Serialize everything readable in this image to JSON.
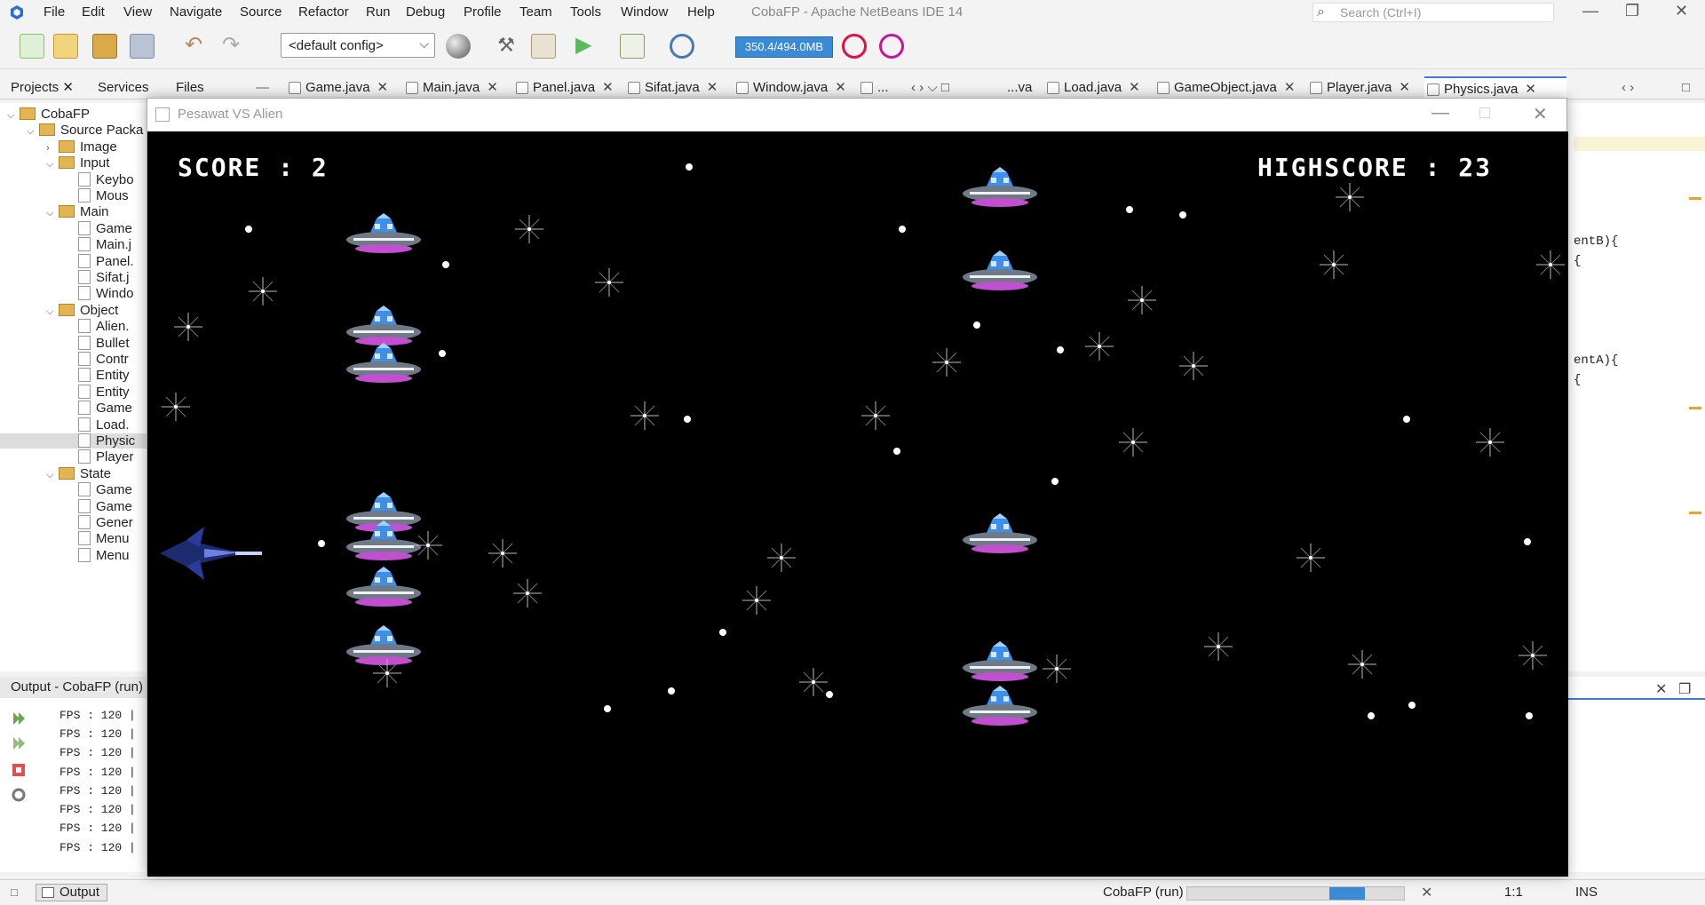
{
  "ide": {
    "menus": [
      "File",
      "Edit",
      "View",
      "Navigate",
      "Source",
      "Refactor",
      "Run",
      "Debug",
      "Profile",
      "Team",
      "Tools",
      "Window",
      "Help"
    ],
    "window_title": "CobaFP - Apache NetBeans IDE 14",
    "search_placeholder": "Search (Ctrl+I)",
    "config_value": "<default config>",
    "memory": "350.4/494.0MB",
    "panel_tabs": [
      "Projects",
      "Services",
      "Files"
    ],
    "editor_tabs": [
      "Game.java",
      "Main.java",
      "Panel.java",
      "Sifat.java",
      "Window.java",
      "...",
      "...va",
      "Load.java",
      "GameObject.java",
      "Player.java",
      "Physics.java"
    ],
    "active_tab": "Physics.java",
    "tree": [
      {
        "label": "CobaFP",
        "level": 0,
        "kind": "project"
      },
      {
        "label": "Source Packa",
        "level": 1,
        "kind": "folder"
      },
      {
        "label": "Image",
        "level": 2,
        "kind": "package"
      },
      {
        "label": "Input",
        "level": 2,
        "kind": "package"
      },
      {
        "label": "Keybo",
        "level": 3,
        "kind": "file"
      },
      {
        "label": "Mous",
        "level": 3,
        "kind": "file"
      },
      {
        "label": "Main",
        "level": 2,
        "kind": "package"
      },
      {
        "label": "Game",
        "level": 3,
        "kind": "file"
      },
      {
        "label": "Main.j",
        "level": 3,
        "kind": "file"
      },
      {
        "label": "Panel.",
        "level": 3,
        "kind": "file"
      },
      {
        "label": "Sifat.j",
        "level": 3,
        "kind": "file"
      },
      {
        "label": "Windo",
        "level": 3,
        "kind": "file"
      },
      {
        "label": "Object",
        "level": 2,
        "kind": "package"
      },
      {
        "label": "Alien.",
        "level": 3,
        "kind": "file"
      },
      {
        "label": "Bullet",
        "level": 3,
        "kind": "file"
      },
      {
        "label": "Contr",
        "level": 3,
        "kind": "file"
      },
      {
        "label": "Entity",
        "level": 3,
        "kind": "file"
      },
      {
        "label": "Entity",
        "level": 3,
        "kind": "file"
      },
      {
        "label": "Game",
        "level": 3,
        "kind": "file"
      },
      {
        "label": "Load.",
        "level": 3,
        "kind": "file"
      },
      {
        "label": "Physic",
        "level": 3,
        "kind": "file",
        "selected": true
      },
      {
        "label": "Player",
        "level": 3,
        "kind": "file"
      },
      {
        "label": "State",
        "level": 2,
        "kind": "package"
      },
      {
        "label": "Game",
        "level": 3,
        "kind": "file"
      },
      {
        "label": "Game",
        "level": 3,
        "kind": "file"
      },
      {
        "label": "Gener",
        "level": 3,
        "kind": "file"
      },
      {
        "label": "Menu",
        "level": 3,
        "kind": "file"
      },
      {
        "label": "Menu",
        "level": 3,
        "kind": "file"
      }
    ],
    "output_title": "Output - CobaFP (run)",
    "output_lines": [
      "FPS : 120 |",
      "FPS : 120 |",
      "FPS : 120 |",
      "FPS : 120 |",
      "FPS : 120 |",
      "FPS : 120 |",
      "FPS : 120 |",
      "FPS : 120 |"
    ],
    "code_fragments": [
      "entB){",
      "{",
      "entA){",
      "{"
    ],
    "status": {
      "output_label": "Output",
      "project_run": "CobaFP (run)",
      "position": "1:1",
      "mode": "INS"
    }
  },
  "game": {
    "window_title": "Pesawat VS Alien",
    "score_text": "SCORE : 2",
    "highscore_text": "HIGHSCORE : 23"
  }
}
